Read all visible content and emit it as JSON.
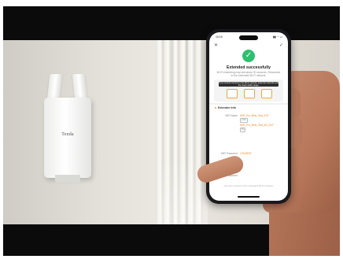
{
  "router": {
    "brand": "Tenda"
  },
  "phone": {
    "status": {
      "time": "10:19",
      "indicators": "▮▮ ◠ ▭"
    },
    "topbar": {
      "close_icon": "close-icon",
      "check_icon": "check-icon",
      "close_glyph": "✕",
      "check_glyph": "✓"
    },
    "success": {
      "icon": "check-circle-icon",
      "glyph": "✓",
      "title": "Extended successfully",
      "description": "Wi-Fi extending may last about 30 seconds. Reconnect to the extended Wi-Fi network."
    },
    "diagram": {
      "label": "If you cannot connect to the Wi-Fi network, keep the extender and the router within range."
    },
    "extender_info": {
      "section_title": "Extender Info",
      "rows": [
        {
          "label": "WiFi Name",
          "value": "WiFi_Pro_Best_Test_EXT",
          "tag": "2.4G"
        },
        {
          "label": "",
          "value": "WiFi_Pro_Best_Test_5G_EXT",
          "tag": "5G"
        },
        {
          "label": "WiFi Password",
          "value": "12345678"
        },
        {
          "label": "Management Address",
          "value": ""
        },
        {
          "label": "Management Password",
          "value": ""
        }
      ]
    },
    "footnote": "You can connect to the extended Wi-Fi network."
  },
  "colors": {
    "accent": "#f08a24",
    "success": "#2fbf71"
  }
}
